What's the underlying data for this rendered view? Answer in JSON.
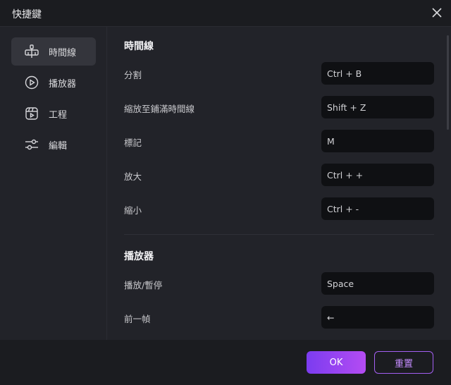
{
  "window": {
    "title": "快捷鍵"
  },
  "sidebar": {
    "items": [
      {
        "label": "時間線",
        "icon": "timeline-icon",
        "active": true
      },
      {
        "label": "播放器",
        "icon": "play-circle-icon",
        "active": false
      },
      {
        "label": "工程",
        "icon": "project-clapper-icon",
        "active": false
      },
      {
        "label": "編輯",
        "icon": "sliders-icon",
        "active": false
      }
    ]
  },
  "sections": [
    {
      "title": "時間線",
      "rows": [
        {
          "label": "分割",
          "shortcut": "Ctrl + B"
        },
        {
          "label": "縮放至鋪滿時間線",
          "shortcut": "Shift + Z"
        },
        {
          "label": "標記",
          "shortcut": "M"
        },
        {
          "label": "放大",
          "shortcut": "Ctrl + +"
        },
        {
          "label": "縮小",
          "shortcut": "Ctrl + -"
        }
      ]
    },
    {
      "title": "播放器",
      "rows": [
        {
          "label": "播放/暫停",
          "shortcut": "Space"
        },
        {
          "label": "前一幀",
          "shortcut": "←"
        }
      ]
    }
  ],
  "footer": {
    "ok_label": "OK",
    "reset_label": "重置"
  },
  "colors": {
    "accent": "#9a48f2",
    "accent_text": "#c58cff"
  }
}
